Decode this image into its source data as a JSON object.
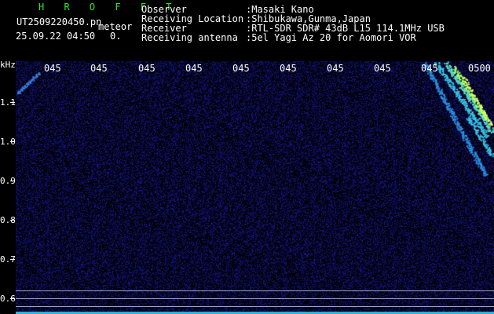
{
  "header": {
    "app_name": "H R O F F T",
    "file_name": "UT2509220450.pn",
    "file_type": "meteor",
    "timestamp": "25.09.22 04:50",
    "count": "0.",
    "labels": {
      "observer": "Observer",
      "location": "Receiving Location",
      "receiver": "Receiver",
      "antenna": "Receiving antenna"
    },
    "values": {
      "observer": ":Masaki Kano",
      "location": ":Shibukawa,Gunma,Japan",
      "receiver": ":RTL-SDR SDR# 43dB L15 114.1MHz USB",
      "antenna": ":5el Yagi Az 20 for Aomori VOR"
    }
  },
  "y_axis": {
    "unit": "kHz",
    "ticks": [
      "1.1",
      "1.0",
      "0.9",
      "0.8",
      "0.7",
      "0.6"
    ]
  },
  "x_axis": {
    "ticks": [
      "045",
      "045",
      "045",
      "045",
      "045",
      "045",
      "045",
      "045",
      "045",
      "0500"
    ]
  },
  "colors": {
    "background": "#000000",
    "noise": "#1a2a8a",
    "trace": "#39c6e8",
    "trace_peak": "#a6ff6a",
    "header_green": "#2ee82e",
    "baseline": "#2ab3d8"
  }
}
